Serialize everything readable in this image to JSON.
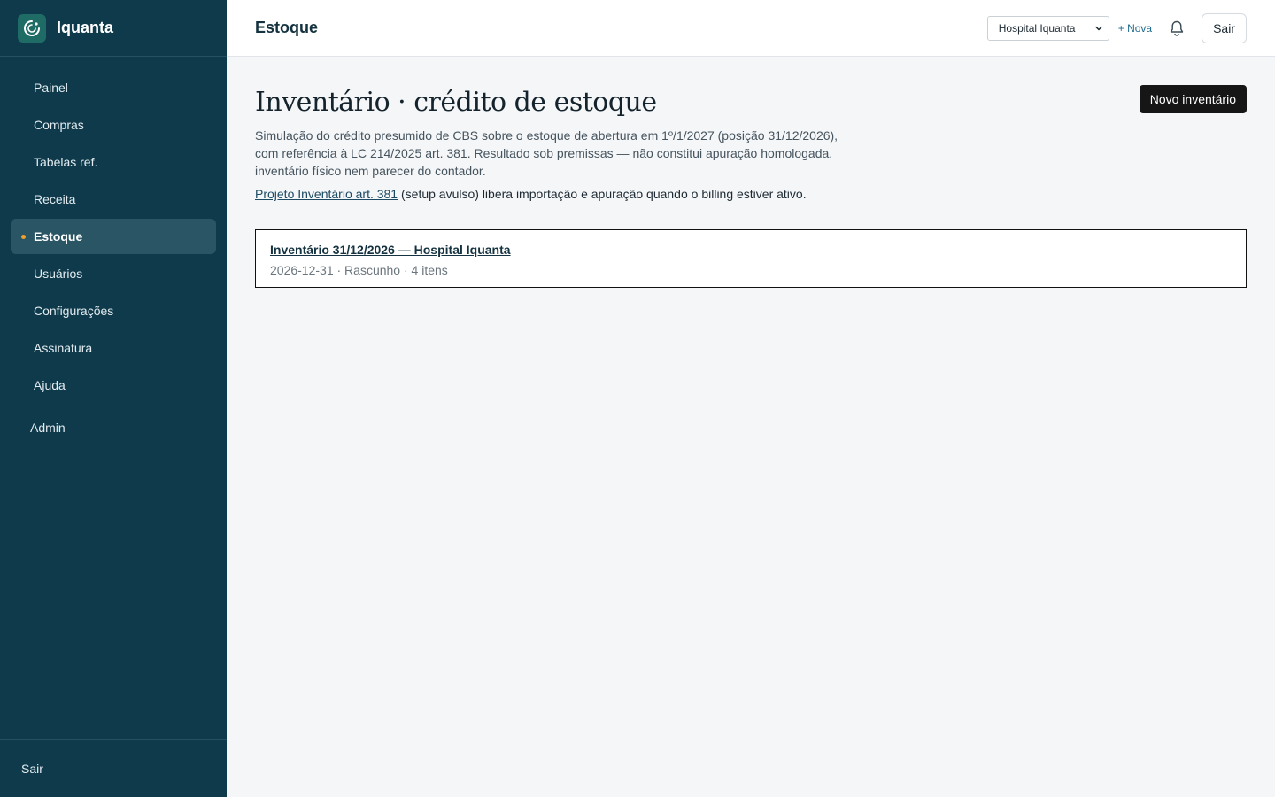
{
  "app": {
    "name": "Iquanta"
  },
  "sidebar": {
    "items": [
      {
        "label": "Painel"
      },
      {
        "label": "Compras"
      },
      {
        "label": "Tabelas ref."
      },
      {
        "label": "Receita"
      },
      {
        "label": "Estoque"
      },
      {
        "label": "Usuários"
      },
      {
        "label": "Configurações"
      },
      {
        "label": "Assinatura"
      },
      {
        "label": "Ajuda"
      }
    ],
    "active_index": 4,
    "admin_label": "Admin",
    "logout_label": "Sair"
  },
  "header": {
    "title": "Estoque",
    "org_select_value": "Hospital Iquanta",
    "new_org_label": "+ Nova",
    "logout_label": "Sair"
  },
  "main": {
    "title": "Inventário · crédito de estoque",
    "new_button_label": "Novo inventário",
    "description": "Simulação do crédito presumido de CBS sobre o estoque de abertura em 1º/1/2027 (posição 31/12/2026), com referência à LC 214/2025 art. 381. Resultado sob premissas — não constitui apuração homologada, inventário físico nem parecer do contador.",
    "note_link": "Projeto Inventário art. 381",
    "note_text": " (setup avulso) libera importação e apuração quando o billing estiver ativo.",
    "inventories": [
      {
        "title": "Inventário 31/12/2026 — Hospital Iquanta",
        "meta": "2026-12-31 · Rascunho · 4 itens"
      }
    ]
  },
  "colors": {
    "sidebar_bg": "#0f3a4b",
    "active_item_bg": "#2a5565",
    "active_dot": "#f0a02a",
    "primary_button": "#161616",
    "link": "#1f6b8f"
  },
  "icons": [
    "logo-icon",
    "chevron-down-icon",
    "bell-icon"
  ]
}
